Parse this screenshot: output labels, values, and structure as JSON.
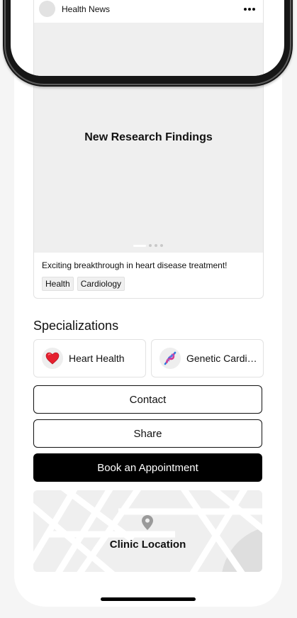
{
  "post": {
    "source": "Health News",
    "image_title": "New Research Findings",
    "carousel": {
      "count": 4,
      "active": 1
    },
    "caption": "Exciting breakthrough in heart disease treatment!",
    "tags": [
      "Health",
      "Cardiology"
    ]
  },
  "specializations": {
    "title": "Specializations",
    "items": [
      {
        "label": "Heart Health",
        "icon": "heart-icon"
      },
      {
        "label": "Genetic Cardiology",
        "icon": "dna-icon"
      }
    ]
  },
  "actions": {
    "contact_label": "Contact",
    "share_label": "Share",
    "book_label": "Book an Appointment"
  },
  "map": {
    "label": "Clinic Location",
    "icon": "location-pin-icon"
  },
  "colors": {
    "accent": "#000000",
    "background": "#f5f5f5",
    "card_border": "#e2e2e2",
    "heart": "#e5202f"
  }
}
